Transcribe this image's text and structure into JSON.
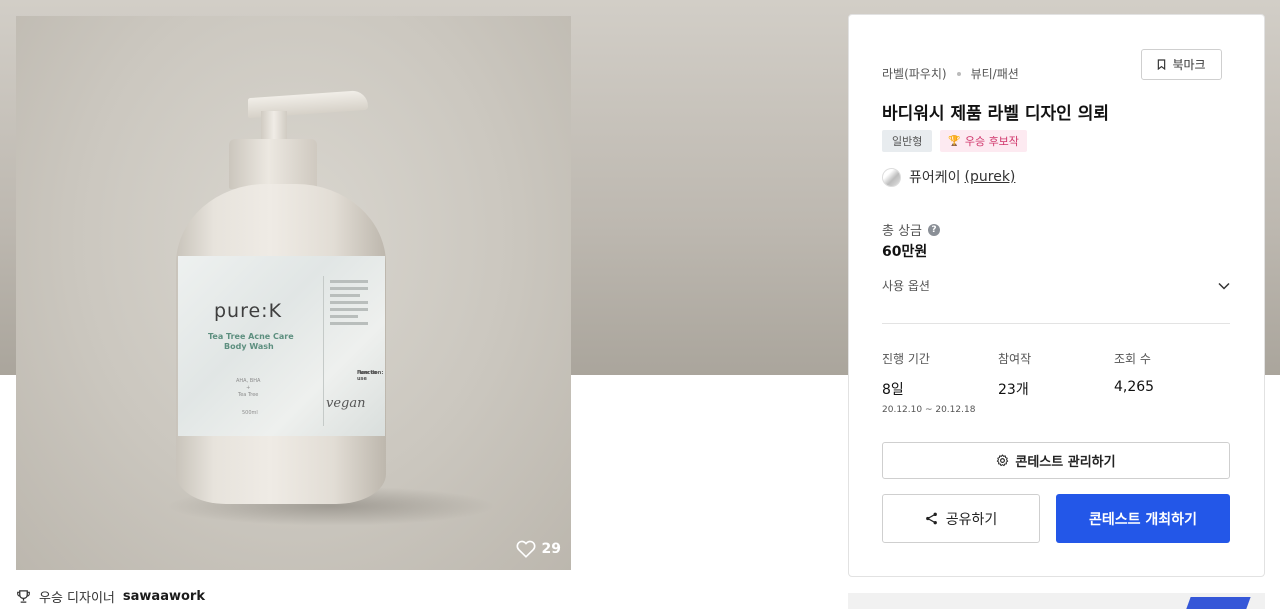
{
  "product": {
    "brand": "pure:K",
    "line1": "Tea Tree Acne Care",
    "line2": "Body Wash",
    "ingredients": "AHA, BHA\n+\nTea Tree",
    "volume": "500ml",
    "side_title": "Function:",
    "side_title2": "How to use",
    "script": "vegan",
    "likes": "29"
  },
  "winner": {
    "prefix": "우승 디자이너",
    "name": "sawaawork"
  },
  "panel": {
    "category": "라벨(파우치)",
    "subcategory": "뷰티/패션",
    "bookmark_label": "북마크",
    "title": "바디워시 제품 라벨 디자인 의뢰",
    "tag_type": "일반형",
    "tag_award": "우승 후보작",
    "host_name": "퓨어케이",
    "host_handle": "(purek)",
    "prize_label": "총 상금",
    "prize_value": "60만원",
    "options_label": "사용 옵션",
    "stats": {
      "period_label": "진행 기간",
      "period_value": "8일",
      "period_range": "20.12.10 ~ 20.12.18",
      "participants_label": "참여작",
      "participants_value": "23개",
      "views_label": "조회 수",
      "views_value": "4,265"
    },
    "manage_button": "콘테스트 관리하기",
    "share_button": "공유하기",
    "host_button": "콘테스트 개최하기"
  },
  "colors": {
    "primary": "#2357e8",
    "award_text": "#d0356b",
    "award_bg": "#fdeaf1"
  }
}
